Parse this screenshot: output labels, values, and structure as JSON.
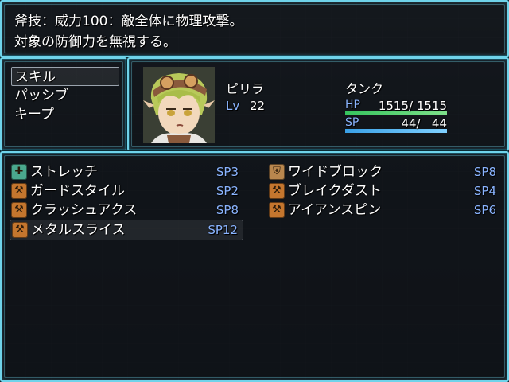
{
  "help": {
    "line1": "斧技：威力100：敵全体に物理攻撃。",
    "line2": "対象の防御力を無視する。"
  },
  "commands": [
    {
      "label": "スキル",
      "selected": true
    },
    {
      "label": "パッシブ",
      "selected": false
    },
    {
      "label": "キープ",
      "selected": false
    }
  ],
  "actor": {
    "name": "ピリラ",
    "class": "タンク",
    "level_label": "Lv",
    "level": "22",
    "hp_label": "HP",
    "hp": "1515/ 1515",
    "hp_ratio": 1.0,
    "sp_label": "SP",
    "sp": "44/   44",
    "sp_ratio": 1.0,
    "hp_color": "#36c45e",
    "sp_color": "#3aa0e6"
  },
  "skills": [
    {
      "name": "ストレッチ",
      "cost": "SP3",
      "icon": "stretch-icon",
      "icon_color": "#4aa88e",
      "selected": false
    },
    {
      "name": "ワイドブロック",
      "cost": "SP8",
      "icon": "wide-block-icon",
      "icon_color": "#b9874e",
      "selected": false
    },
    {
      "name": "ガードスタイル",
      "cost": "SP2",
      "icon": "axe-icon",
      "icon_color": "#c4762e",
      "selected": false
    },
    {
      "name": "ブレイクダスト",
      "cost": "SP4",
      "icon": "axe-icon",
      "icon_color": "#c4762e",
      "selected": false
    },
    {
      "name": "クラッシュアクス",
      "cost": "SP8",
      "icon": "axe-icon",
      "icon_color": "#c4762e",
      "selected": false
    },
    {
      "name": "アイアンスピン",
      "cost": "SP6",
      "icon": "axe-icon",
      "icon_color": "#c4762e",
      "selected": false
    },
    {
      "name": "メタルスライス",
      "cost": "SP12",
      "icon": "axe-icon",
      "icon_color": "#c4762e",
      "selected": true
    }
  ]
}
